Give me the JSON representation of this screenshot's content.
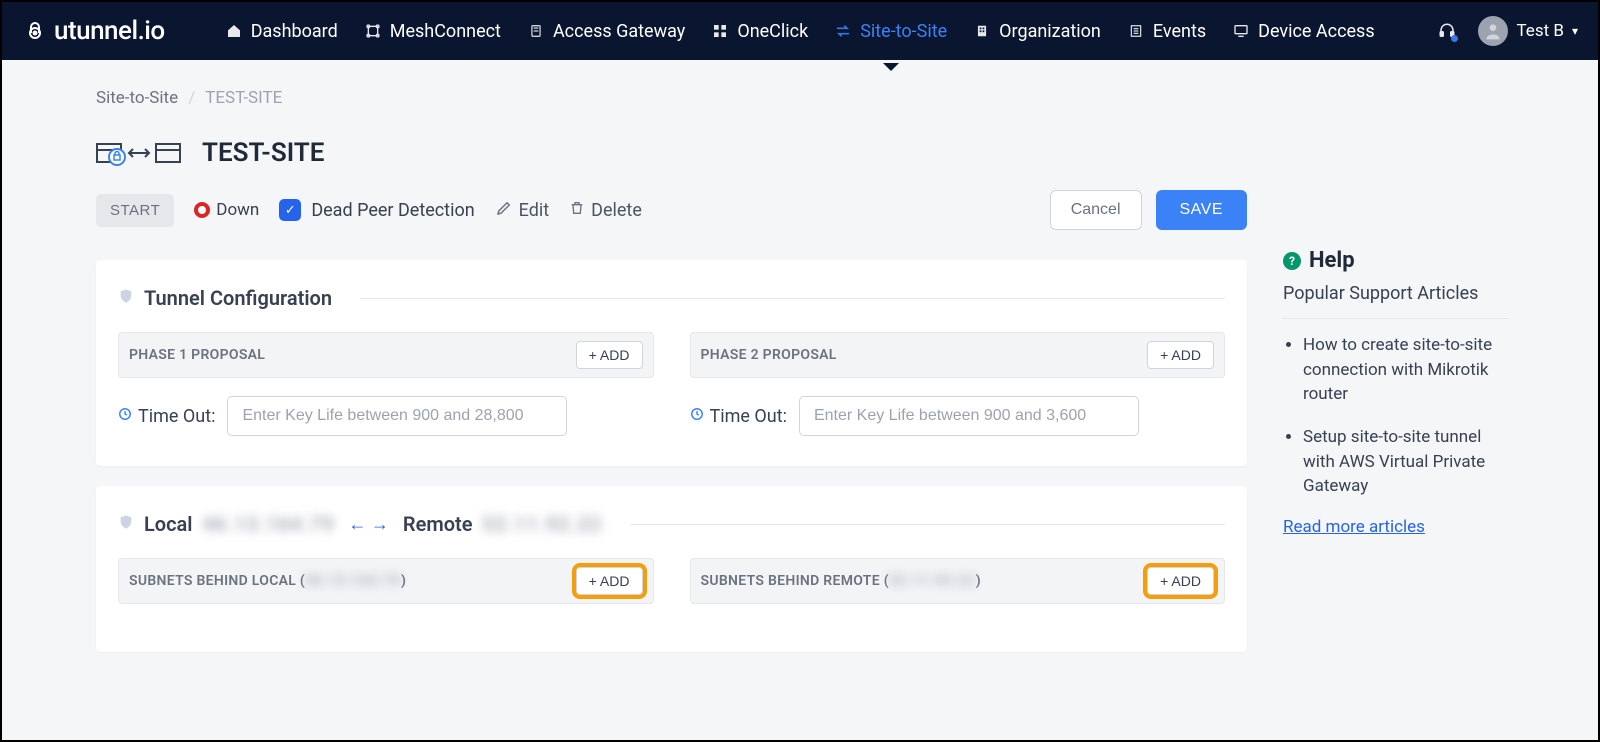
{
  "brand": "utunnel.io",
  "nav": {
    "dashboard": "Dashboard",
    "mesh": "MeshConnect",
    "access": "Access Gateway",
    "oneclick": "OneClick",
    "s2s": "Site-to-Site",
    "org": "Organization",
    "events": "Events",
    "device": "Device Access"
  },
  "user": {
    "name": "Test B"
  },
  "breadcrumb": {
    "root": "Site-to-Site",
    "current": "TEST-SITE"
  },
  "page": {
    "title": "TEST-SITE"
  },
  "actions": {
    "start": "START",
    "status": "Down",
    "dpd": "Dead Peer Detection",
    "edit": "Edit",
    "delete": "Delete",
    "cancel": "Cancel",
    "save": "SAVE"
  },
  "tunnel": {
    "section": "Tunnel Configuration",
    "phase1": {
      "label": "PHASE 1 PROPOSAL",
      "add": "+ ADD",
      "timeout_label": "Time Out:",
      "timeout_ph": "Enter Key Life between 900 and 28,800"
    },
    "phase2": {
      "label": "PHASE 2 PROPOSAL",
      "add": "+ ADD",
      "timeout_label": "Time Out:",
      "timeout_ph": "Enter Key Life between 900 and 3,600"
    }
  },
  "lr": {
    "local_label": "Local",
    "local_ip": "46.13.164.79",
    "remote_label": "Remote",
    "remote_ip": "52.11.92.22",
    "sub_local_label": "SUBNETS BEHIND LOCAL (",
    "sub_local_ip": "46.13.164.79",
    "sub_local_close": ")",
    "sub_local_add": "+ ADD",
    "sub_remote_label": "SUBNETS BEHIND REMOTE (",
    "sub_remote_ip": "52.11.92.22",
    "sub_remote_close": ")",
    "sub_remote_add": "+ ADD"
  },
  "help": {
    "title": "Help",
    "subtitle": "Popular Support Articles",
    "a1": "How to create site-to-site connection with Mikrotik router",
    "a2": "Setup site-to-site tunnel with AWS Virtual Private Gateway",
    "more": "Read more articles"
  }
}
